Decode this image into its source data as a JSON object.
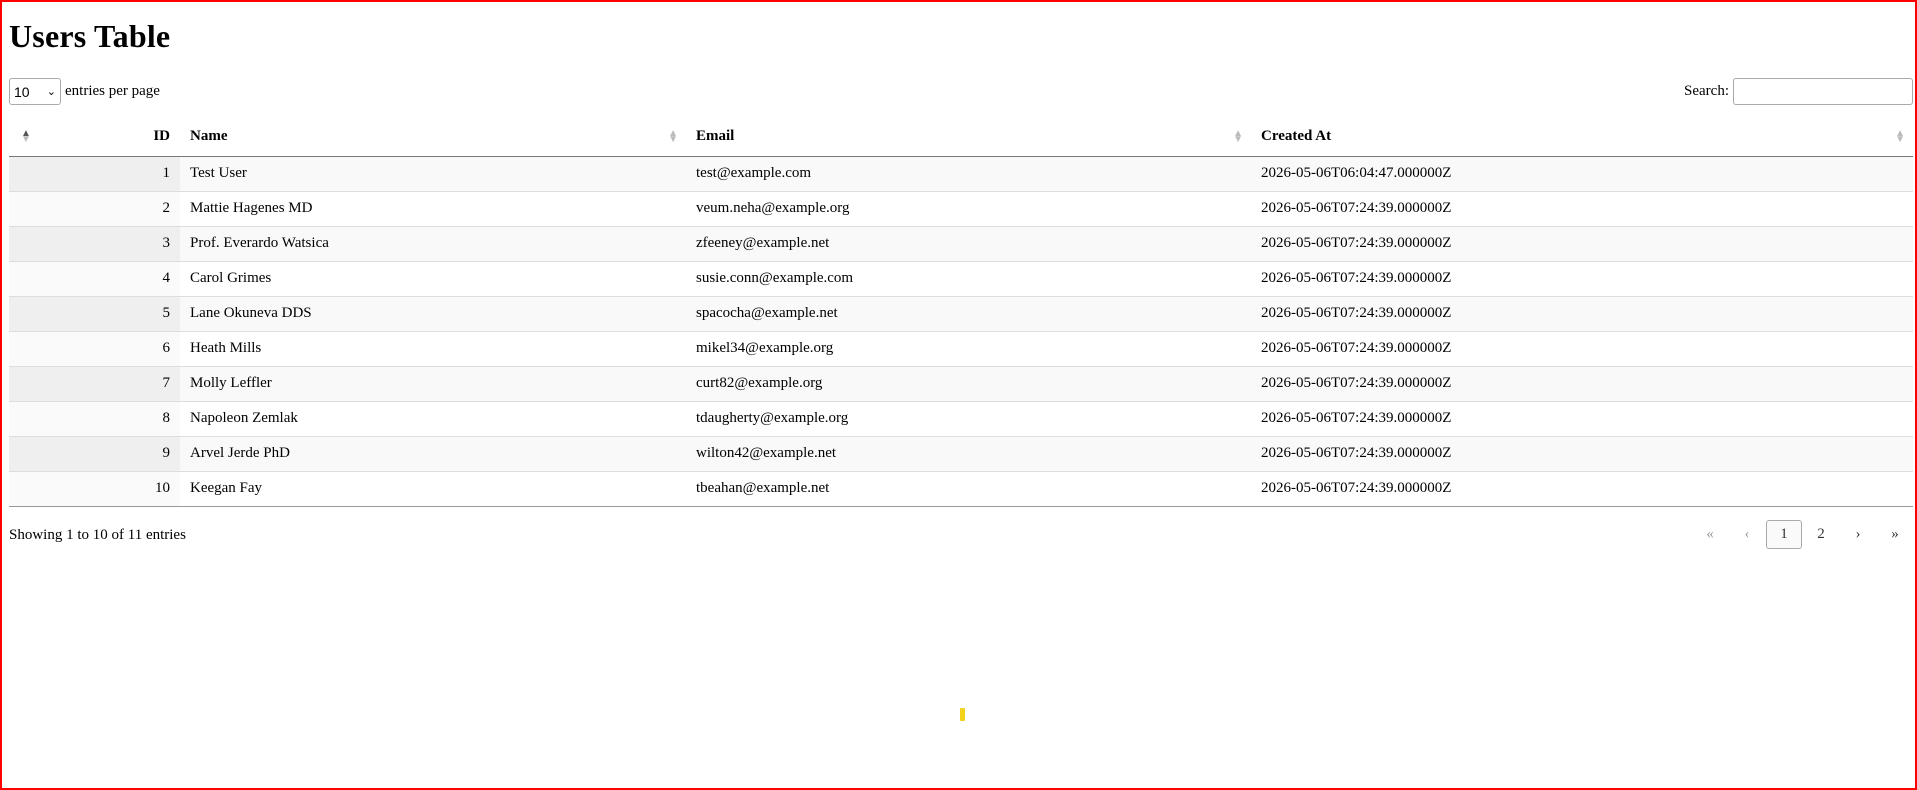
{
  "page": {
    "title": "Users Table"
  },
  "controls": {
    "length_value": "10",
    "length_label": "entries per page",
    "search_label": "Search:",
    "search_value": ""
  },
  "table": {
    "columns": [
      "ID",
      "Name",
      "Email",
      "Created At"
    ],
    "rows": [
      {
        "id": "1",
        "name": "Test User",
        "email": "test@example.com",
        "created": "2026-05-06T06:04:47.000000Z"
      },
      {
        "id": "2",
        "name": "Mattie Hagenes MD",
        "email": "veum.neha@example.org",
        "created": "2026-05-06T07:24:39.000000Z"
      },
      {
        "id": "3",
        "name": "Prof. Everardo Watsica",
        "email": "zfeeney@example.net",
        "created": "2026-05-06T07:24:39.000000Z"
      },
      {
        "id": "4",
        "name": "Carol Grimes",
        "email": "susie.conn@example.com",
        "created": "2026-05-06T07:24:39.000000Z"
      },
      {
        "id": "5",
        "name": "Lane Okuneva DDS",
        "email": "spacocha@example.net",
        "created": "2026-05-06T07:24:39.000000Z"
      },
      {
        "id": "6",
        "name": "Heath Mills",
        "email": "mikel34@example.org",
        "created": "2026-05-06T07:24:39.000000Z"
      },
      {
        "id": "7",
        "name": "Molly Leffler",
        "email": "curt82@example.org",
        "created": "2026-05-06T07:24:39.000000Z"
      },
      {
        "id": "8",
        "name": "Napoleon Zemlak",
        "email": "tdaugherty@example.org",
        "created": "2026-05-06T07:24:39.000000Z"
      },
      {
        "id": "9",
        "name": "Arvel Jerde PhD",
        "email": "wilton42@example.net",
        "created": "2026-05-06T07:24:39.000000Z"
      },
      {
        "id": "10",
        "name": "Keegan Fay",
        "email": "tbeahan@example.net",
        "created": "2026-05-06T07:24:39.000000Z"
      }
    ]
  },
  "footer": {
    "info": "Showing 1 to 10 of 11 entries",
    "pager": {
      "first": "«",
      "prev": "‹",
      "pages": [
        "1",
        "2"
      ],
      "current": "1",
      "next": "›",
      "last": "»"
    }
  },
  "icons": {
    "sort": "sort-icon",
    "chevron": "chevron-down-icon"
  },
  "colors": {
    "border": "#ff0000",
    "marker": "#f2d21a"
  }
}
